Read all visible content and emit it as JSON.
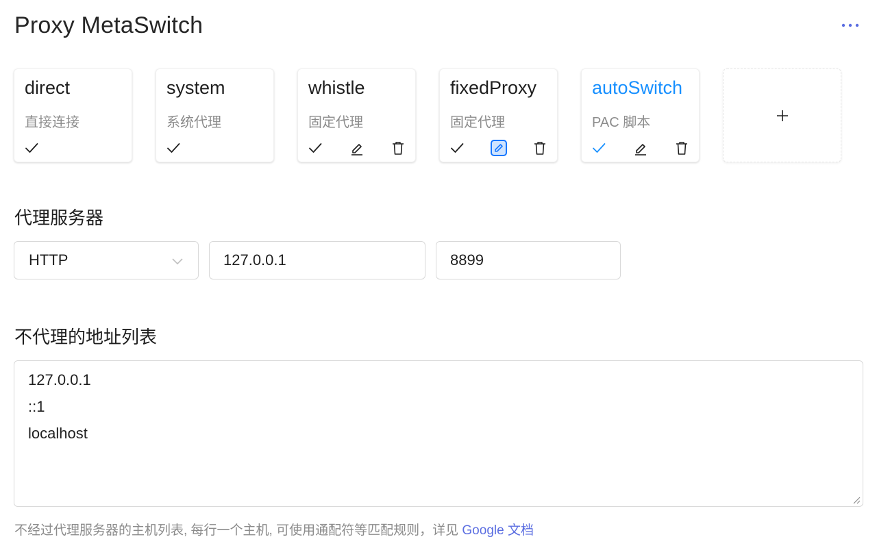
{
  "header": {
    "title": "Proxy MetaSwitch",
    "more_icon": "more-horizontal-icon",
    "accent": "#5b6ee1"
  },
  "profiles": [
    {
      "name": "direct",
      "desc": "直接连接",
      "active": false,
      "actions": [
        "check"
      ]
    },
    {
      "name": "system",
      "desc": "系统代理",
      "active": false,
      "actions": [
        "check"
      ]
    },
    {
      "name": "whistle",
      "desc": "固定代理",
      "active": false,
      "actions": [
        "check",
        "edit",
        "delete"
      ]
    },
    {
      "name": "fixedProxy",
      "desc": "固定代理",
      "active": false,
      "editing": true,
      "actions": [
        "check",
        "edit",
        "delete"
      ]
    },
    {
      "name": "autoSwitch",
      "desc": "PAC 脚本",
      "active": true,
      "actions": [
        "check",
        "edit",
        "delete"
      ]
    }
  ],
  "add_profile": {
    "label": "+"
  },
  "proxy_server": {
    "label": "代理服务器",
    "protocol": "HTTP",
    "host": "127.0.0.1",
    "port": "8899"
  },
  "bypass": {
    "label": "不代理的地址列表",
    "value": "127.0.0.1\n::1\nlocalhost",
    "help_text": "不经过代理服务器的主机列表, 每行一个主机, 可使用通配符等匹配规则，详见 ",
    "help_link": "Google 文档"
  },
  "colors": {
    "active_blue": "#1890ff",
    "edit_active": "#1677ff",
    "link": "#5b6ee1",
    "muted": "#8c8c8c",
    "border": "#d9d9d9"
  }
}
